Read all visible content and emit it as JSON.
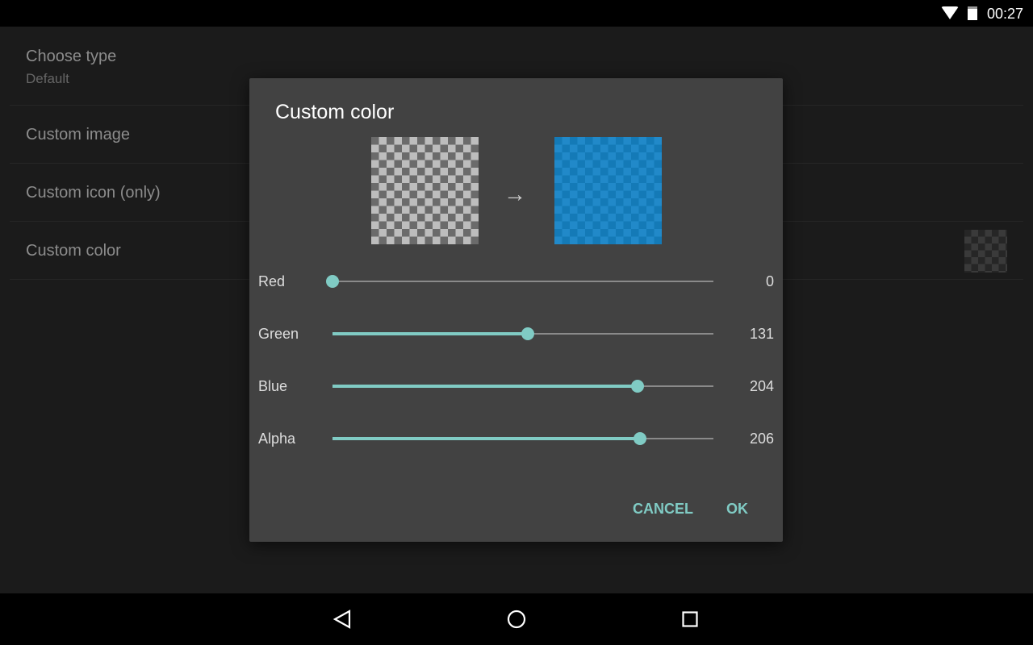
{
  "status": {
    "time": "00:27"
  },
  "list": [
    {
      "title": "Choose type",
      "subtitle": "Default"
    },
    {
      "title": "Custom image"
    },
    {
      "title": "Custom icon (only)"
    },
    {
      "title": "Custom color"
    }
  ],
  "dialog": {
    "title": "Custom color",
    "arrow": "→",
    "sliders": [
      {
        "label": "Red",
        "value": "0",
        "fraction": 0
      },
      {
        "label": "Green",
        "value": "131",
        "fraction": 0.5137
      },
      {
        "label": "Blue",
        "value": "204",
        "fraction": 0.8
      },
      {
        "label": "Alpha",
        "value": "206",
        "fraction": 0.8078
      }
    ],
    "cancel": "CANCEL",
    "ok": "OK"
  },
  "colors": {
    "accent": "#80cbc4",
    "preview": "#0083cc"
  }
}
